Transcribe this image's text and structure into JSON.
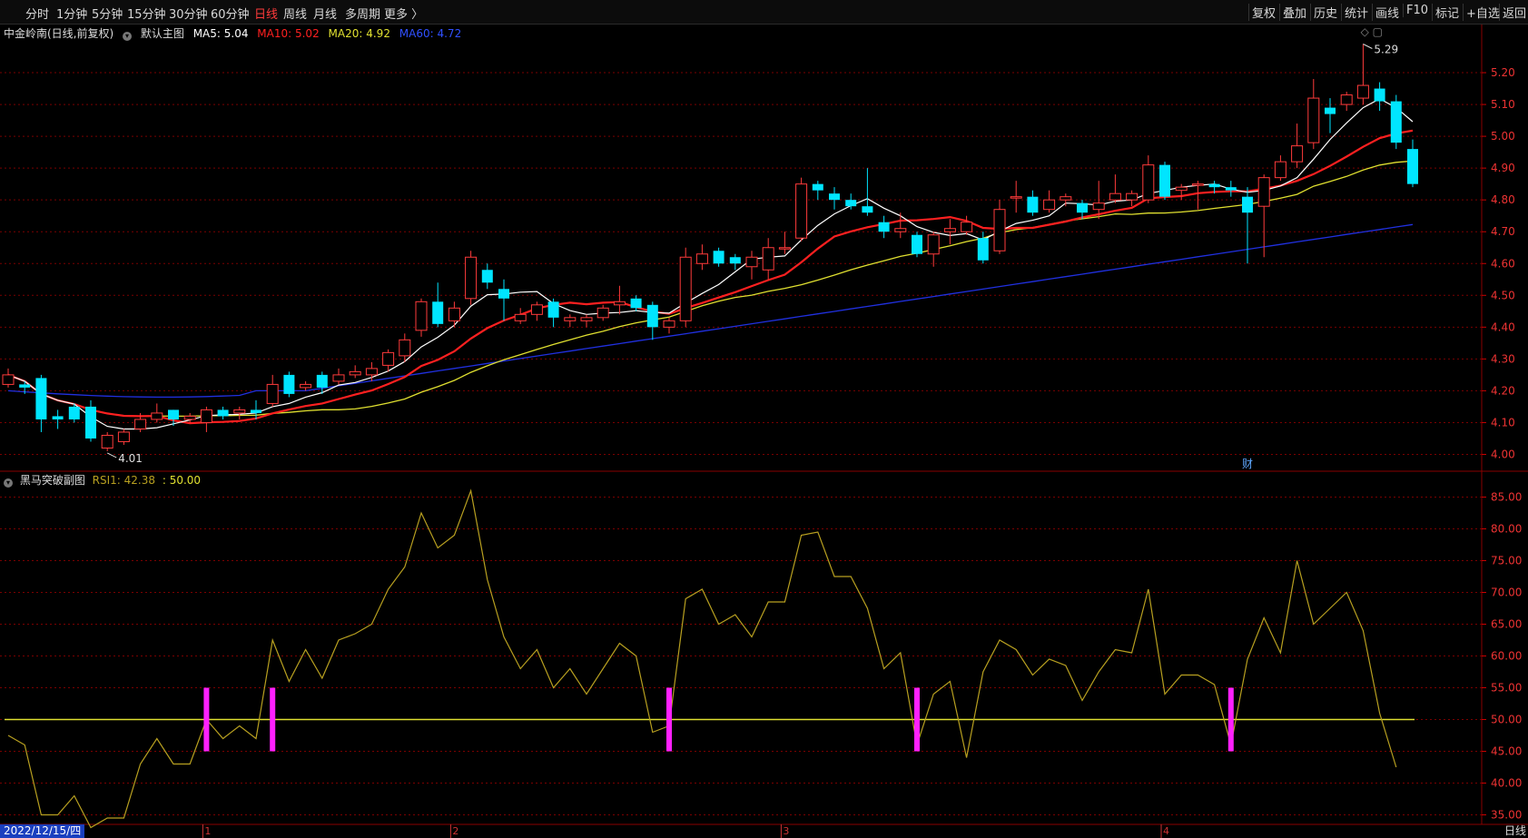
{
  "toolbar": {
    "periods": [
      {
        "label": "分时",
        "x": 28,
        "active": false
      },
      {
        "label": "1分钟",
        "x": 62,
        "active": false
      },
      {
        "label": "5分钟",
        "x": 101,
        "active": false
      },
      {
        "label": "15分钟",
        "x": 140,
        "active": false
      },
      {
        "label": "30分钟",
        "x": 186,
        "active": false
      },
      {
        "label": "60分钟",
        "x": 232,
        "active": false
      },
      {
        "label": "日线",
        "x": 280,
        "active": true
      },
      {
        "label": "周线",
        "x": 312,
        "active": false
      },
      {
        "label": "月线",
        "x": 345,
        "active": false
      },
      {
        "label": "多周期",
        "x": 380,
        "active": false
      },
      {
        "label": "更多 〉",
        "x": 423,
        "active": false
      }
    ],
    "right_buttons": [
      "复权",
      "叠加",
      "历史",
      "统计",
      "画线",
      "F10",
      "标记",
      "+自选",
      "返回"
    ]
  },
  "main_legend": {
    "stock": "中金岭南(日线,前复权)",
    "template": "默认主图",
    "ma5": "MA5: 5.04",
    "ma10": "MA10: 5.02",
    "ma20": "MA20: 4.92",
    "ma60": "MA60: 4.72"
  },
  "sub_legend": {
    "name": "黑马突破副图",
    "rsi": "RSI1: 42.38",
    "level": ": 50.00"
  },
  "colors": {
    "up": "#ff3b3b",
    "down": "#00e5ff",
    "ma5": "#ffffff",
    "ma10": "#ff2020",
    "ma20": "#e0e030",
    "ma60": "#2030e0",
    "rsi": "#b8a020",
    "signal": "#ff20ff",
    "level": "#e0e030"
  },
  "chart_data": [
    {
      "type": "candlestick",
      "title": "中金岭南(日线,前复权)",
      "ylim": [
        3.95,
        5.3
      ],
      "yticks": [
        "5.20",
        "5.10",
        "5.00",
        "4.90",
        "4.80",
        "4.70",
        "4.60",
        "4.50",
        "4.40",
        "4.30",
        "4.20",
        "4.10",
        "4.00"
      ],
      "high_label": "5.29",
      "low_label": "4.01",
      "annotation": "财",
      "candles": [
        [
          4.22,
          4.25,
          4.27,
          4.21
        ],
        [
          4.22,
          4.21,
          4.23,
          4.19
        ],
        [
          4.24,
          4.11,
          4.25,
          4.07
        ],
        [
          4.12,
          4.11,
          4.14,
          4.08
        ],
        [
          4.15,
          4.11,
          4.16,
          4.1
        ],
        [
          4.15,
          4.05,
          4.17,
          4.04
        ],
        [
          4.02,
          4.06,
          4.07,
          4.01
        ],
        [
          4.04,
          4.07,
          4.08,
          4.03
        ],
        [
          4.08,
          4.11,
          4.13,
          4.07
        ],
        [
          4.11,
          4.13,
          4.16,
          4.1
        ],
        [
          4.14,
          4.11,
          4.14,
          4.09
        ],
        [
          4.11,
          4.12,
          4.13,
          4.1
        ],
        [
          4.1,
          4.14,
          4.15,
          4.07
        ],
        [
          4.14,
          4.12,
          4.15,
          4.11
        ],
        [
          4.13,
          4.14,
          4.15,
          4.11
        ],
        [
          4.14,
          4.13,
          4.17,
          4.11
        ],
        [
          4.16,
          4.22,
          4.25,
          4.15
        ],
        [
          4.25,
          4.19,
          4.26,
          4.18
        ],
        [
          4.21,
          4.22,
          4.23,
          4.2
        ],
        [
          4.25,
          4.21,
          4.26,
          4.19
        ],
        [
          4.23,
          4.25,
          4.27,
          4.22
        ],
        [
          4.25,
          4.26,
          4.28,
          4.24
        ],
        [
          4.25,
          4.27,
          4.29,
          4.23
        ],
        [
          4.28,
          4.32,
          4.33,
          4.26
        ],
        [
          4.31,
          4.36,
          4.38,
          4.29
        ],
        [
          4.39,
          4.48,
          4.49,
          4.37
        ],
        [
          4.48,
          4.41,
          4.54,
          4.4
        ],
        [
          4.42,
          4.46,
          4.48,
          4.4
        ],
        [
          4.49,
          4.62,
          4.64,
          4.47
        ],
        [
          4.58,
          4.54,
          4.6,
          4.52
        ],
        [
          4.52,
          4.49,
          4.55,
          4.42
        ],
        [
          4.42,
          4.44,
          4.46,
          4.41
        ],
        [
          4.44,
          4.47,
          4.48,
          4.42
        ],
        [
          4.48,
          4.43,
          4.49,
          4.4
        ],
        [
          4.42,
          4.43,
          4.44,
          4.4
        ],
        [
          4.42,
          4.43,
          4.44,
          4.4
        ],
        [
          4.43,
          4.46,
          4.47,
          4.42
        ],
        [
          4.47,
          4.48,
          4.53,
          4.44
        ],
        [
          4.49,
          4.46,
          4.5,
          4.45
        ],
        [
          4.47,
          4.4,
          4.48,
          4.36
        ],
        [
          4.4,
          4.42,
          4.43,
          4.38
        ],
        [
          4.42,
          4.62,
          4.65,
          4.4
        ],
        [
          4.6,
          4.63,
          4.66,
          4.58
        ],
        [
          4.64,
          4.6,
          4.65,
          4.59
        ],
        [
          4.62,
          4.6,
          4.63,
          4.58
        ],
        [
          4.59,
          4.62,
          4.64,
          4.55
        ],
        [
          4.58,
          4.65,
          4.68,
          4.55
        ],
        [
          4.65,
          4.65,
          4.7,
          4.63
        ],
        [
          4.68,
          4.85,
          4.87,
          4.67
        ],
        [
          4.85,
          4.83,
          4.86,
          4.8
        ],
        [
          4.82,
          4.8,
          4.84,
          4.77
        ],
        [
          4.8,
          4.78,
          4.82,
          4.77
        ],
        [
          4.78,
          4.76,
          4.9,
          4.75
        ],
        [
          4.73,
          4.7,
          4.75,
          4.68
        ],
        [
          4.7,
          4.71,
          4.76,
          4.68
        ],
        [
          4.69,
          4.63,
          4.7,
          4.62
        ],
        [
          4.63,
          4.69,
          4.7,
          4.59
        ],
        [
          4.7,
          4.71,
          4.74,
          4.66
        ],
        [
          4.7,
          4.73,
          4.75,
          4.69
        ],
        [
          4.68,
          4.61,
          4.7,
          4.6
        ],
        [
          4.64,
          4.77,
          4.8,
          4.63
        ],
        [
          4.81,
          4.81,
          4.86,
          4.76
        ],
        [
          4.81,
          4.76,
          4.83,
          4.75
        ],
        [
          4.77,
          4.8,
          4.83,
          4.76
        ],
        [
          4.8,
          4.81,
          4.82,
          4.78
        ],
        [
          4.79,
          4.76,
          4.8,
          4.74
        ],
        [
          4.77,
          4.79,
          4.86,
          4.74
        ],
        [
          4.8,
          4.82,
          4.88,
          4.79
        ],
        [
          4.8,
          4.82,
          4.83,
          4.78
        ],
        [
          4.8,
          4.91,
          4.94,
          4.79
        ],
        [
          4.91,
          4.81,
          4.92,
          4.8
        ],
        [
          4.83,
          4.84,
          4.85,
          4.8
        ],
        [
          4.85,
          4.85,
          4.86,
          4.77
        ],
        [
          4.85,
          4.84,
          4.86,
          4.82
        ],
        [
          4.84,
          4.83,
          4.86,
          4.81
        ],
        [
          4.81,
          4.76,
          4.84,
          4.6
        ],
        [
          4.78,
          4.87,
          4.88,
          4.62
        ],
        [
          4.87,
          4.92,
          4.94,
          4.86
        ],
        [
          4.92,
          4.97,
          5.04,
          4.9
        ],
        [
          4.98,
          5.12,
          5.18,
          4.96
        ],
        [
          5.09,
          5.07,
          5.12,
          5.01
        ],
        [
          5.1,
          5.13,
          5.14,
          5.08
        ],
        [
          5.12,
          5.16,
          5.29,
          5.1
        ],
        [
          5.15,
          5.11,
          5.17,
          5.08
        ],
        [
          5.11,
          4.98,
          5.13,
          4.96
        ],
        [
          4.96,
          4.85,
          4.99,
          4.84
        ]
      ]
    },
    {
      "type": "line",
      "title": "黑马突破副图",
      "ylim": [
        33.5,
        87.5
      ],
      "yticks": [
        "85.00",
        "80.00",
        "75.00",
        "70.00",
        "65.00",
        "60.00",
        "55.00",
        "50.00",
        "45.00",
        "40.00",
        "35.00"
      ],
      "rsi": [
        47.5,
        46,
        35,
        35,
        38,
        33,
        34.5,
        34.5,
        43,
        47,
        43,
        43,
        50,
        47,
        49,
        47,
        62.5,
        56,
        61,
        56.5,
        62.5,
        63.5,
        65,
        70.5,
        74,
        82.5,
        77,
        79,
        86,
        72,
        63,
        58,
        61,
        55,
        58,
        54,
        58,
        62,
        60,
        48,
        49,
        69,
        70.5,
        65,
        66.5,
        63,
        68.5,
        68.5,
        79,
        79.5,
        72.5,
        72.5,
        67.5,
        58,
        60.5,
        46,
        54,
        56,
        44,
        57.5,
        62.5,
        61,
        57,
        59.5,
        58.5,
        53,
        57.5,
        61,
        60.5,
        70.5,
        54,
        57,
        57,
        55.5,
        46,
        59.5,
        66,
        60.5,
        75,
        65,
        67.5,
        70,
        64,
        51,
        42.5
      ],
      "level": 50,
      "signals": [
        12,
        16,
        40,
        55,
        74
      ]
    }
  ],
  "month_ticks": [
    {
      "label": "1",
      "i": 12
    },
    {
      "label": "2",
      "i": 27
    },
    {
      "label": "3",
      "i": 47
    },
    {
      "label": "4",
      "i": 70
    }
  ],
  "bottom": {
    "date": "2022/12/15/四",
    "period": "日线"
  }
}
